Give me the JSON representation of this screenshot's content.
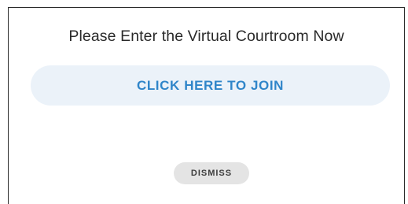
{
  "dialog": {
    "prompt": "Please Enter the Virtual Courtroom Now",
    "join_label": "CLICK HERE TO JOIN",
    "dismiss_label": "DISMISS"
  },
  "colors": {
    "join_text": "#2f85c9",
    "join_background": "#ebf2f9",
    "dismiss_background": "#e4e4e4"
  }
}
